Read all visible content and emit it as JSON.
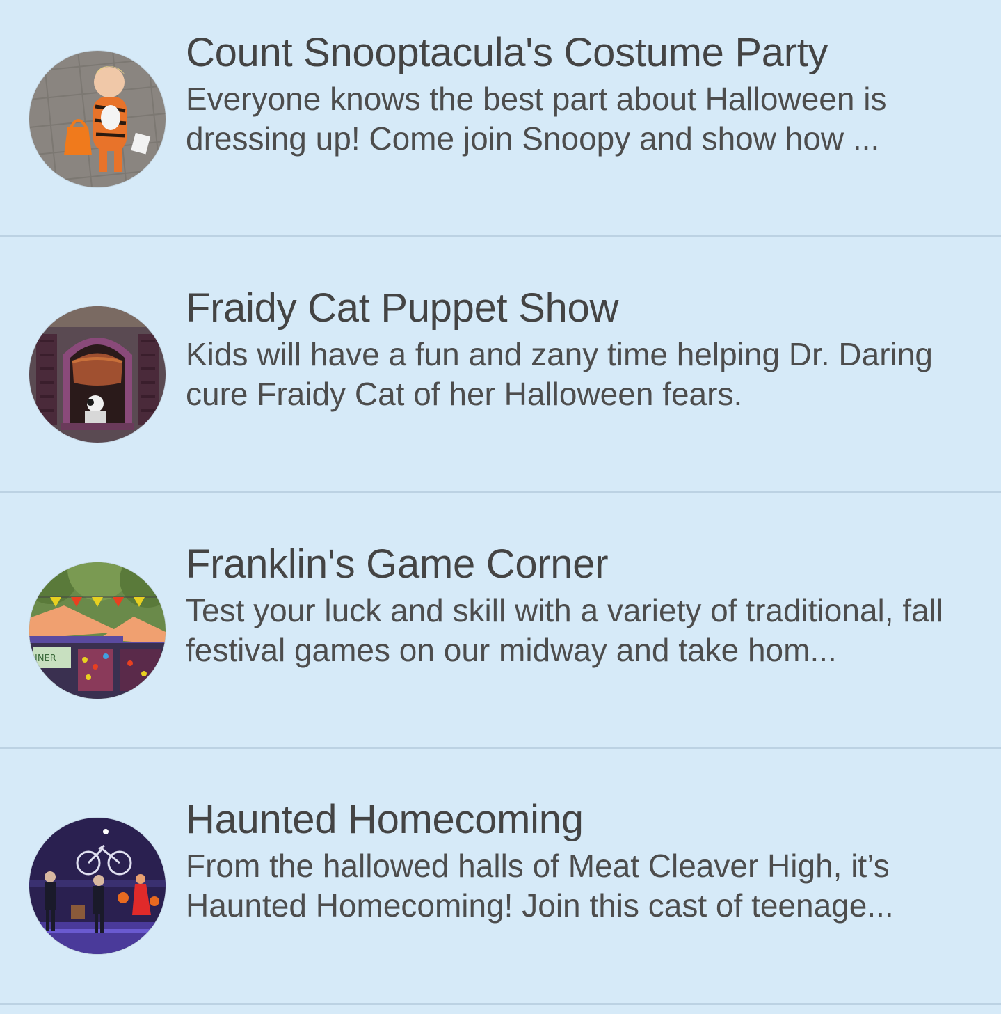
{
  "events": [
    {
      "title": "Count Snooptacula's Costume Party",
      "description": "Everyone knows the best part about Halloween is dressing up! Come join Snoopy and show how ...",
      "thumbnail": "child-tiger-costume-photo"
    },
    {
      "title": "Fraidy Cat Puppet Show",
      "description": "Kids will have a fun and zany time helping Dr. Daring cure Fraidy Cat of her Halloween fears.",
      "thumbnail": "puppet-window-stage-photo"
    },
    {
      "title": "Franklin's Game Corner",
      "description": "Test your luck and skill with a variety of traditional, fall festival games on our midway and take hom...",
      "thumbnail": "festival-tents-photo"
    },
    {
      "title": "Haunted Homecoming",
      "description": "From the hallowed halls of Meat Cleaver High, it’s Haunted Homecoming! Join this cast of teenage...",
      "thumbnail": "stage-performance-photo"
    }
  ],
  "colors": {
    "background": "#d6eaf8",
    "divider": "#bcd2e3",
    "text": "#444444"
  }
}
